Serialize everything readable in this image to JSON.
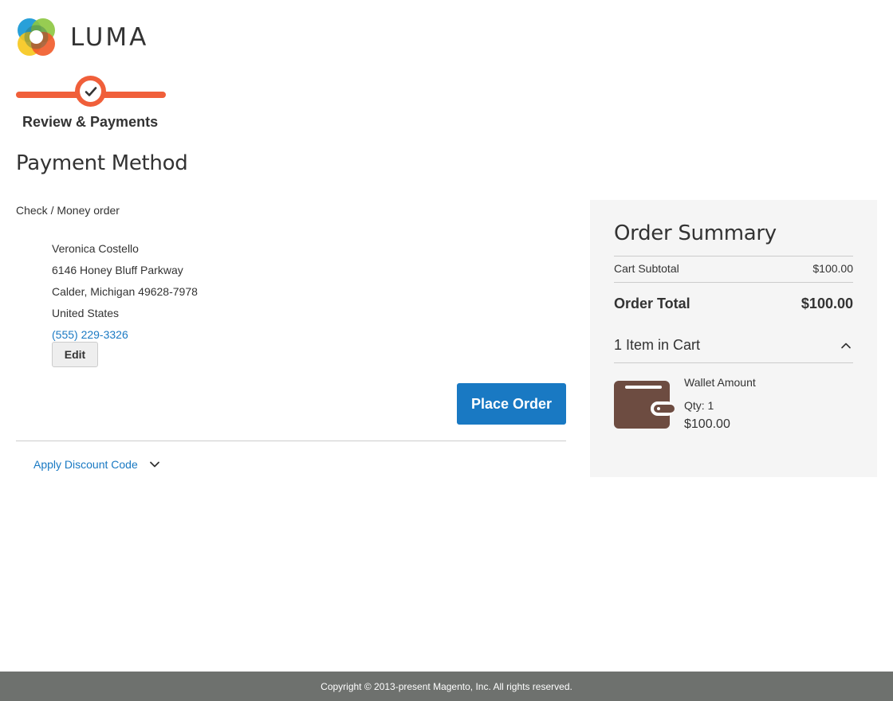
{
  "header": {
    "logo_text": "LUMA",
    "logo_icon": "luma-logo-icon"
  },
  "progress": {
    "step_label": "Review & Payments",
    "step_icon": "checkmark-icon",
    "accent_color": "#f05f3a"
  },
  "payment": {
    "section_title": "Payment Method",
    "method_label": "Check / Money order",
    "address": {
      "name": "Veronica Costello",
      "street": "6146 Honey Bluff Parkway",
      "city_line": "Calder, Michigan 49628-7978",
      "country": "United States",
      "phone": "(555) 229-3326"
    },
    "edit_label": "Edit",
    "place_order_label": "Place Order",
    "place_order_color": "#1979c3"
  },
  "discount": {
    "label": "Apply Discount Code",
    "icon": "chevron-down-icon"
  },
  "summary": {
    "title": "Order Summary",
    "subtotal_label": "Cart Subtotal",
    "subtotal_value": "$100.00",
    "total_label": "Order Total",
    "total_value": "$100.00",
    "items_label": "1 Item in Cart",
    "items_toggle_icon": "chevron-up-icon",
    "item": {
      "name": "Wallet Amount",
      "qty": "Qty: 1",
      "price": "$100.00",
      "thumb_icon": "wallet-icon"
    }
  },
  "footer": {
    "copyright": "Copyright © 2013-present Magento, Inc. All rights reserved."
  }
}
